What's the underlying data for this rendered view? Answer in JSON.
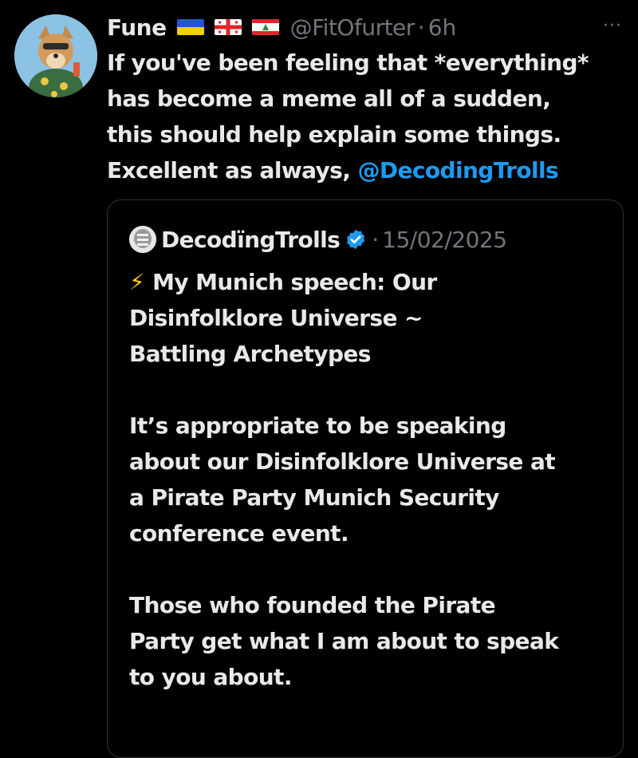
{
  "post": {
    "author": {
      "display_name": "Fune",
      "flags": [
        "flag-ukraine-icon",
        "flag-georgia-icon",
        "flag-lebanon-icon"
      ],
      "handle": "@FitOfurter",
      "separator": "·",
      "time": "6h"
    },
    "more_icon": "···",
    "text_lines": "If you've been feeling that *everything*\nhas become a meme all of a sudden,\nthis should help explain some things.\nExcellent as always, ",
    "mention": "@DecodingTrolls"
  },
  "quoted_post": {
    "author": {
      "display_name": "DecodïngTrolls",
      "verified_icon": "verified-badge-icon",
      "separator": "·",
      "date": "15/02/2025"
    },
    "bolt_icon": "⚡",
    "paragraphs": [
      "My Munich speech: Our\nDisinfolklore Universe ~\nBattling Archetypes",
      "It’s appropriate to be speaking\nabout our Disinfolklore Universe at\na Pirate Party Munich Security\nconference event.",
      "Those who founded the Pirate\nParty get what I am about to speak\nto you about."
    ]
  },
  "colors": {
    "background": "#000000",
    "text": "#e7e9ea",
    "muted": "#71767b",
    "link": "#1d9bf0",
    "verified": "#1d9bf0",
    "border": "#2f3336"
  }
}
